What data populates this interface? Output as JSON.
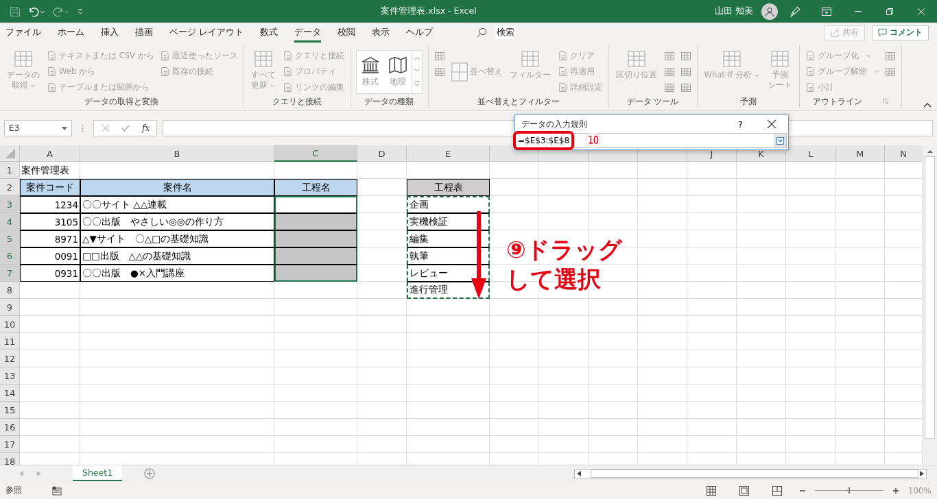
{
  "title_bar": {
    "title": "案件管理表.xlsx  -  Excel",
    "user": "山田 知美"
  },
  "ribbon_tabs": [
    {
      "label": "ファイル",
      "selected": false
    },
    {
      "label": "ホーム",
      "selected": false
    },
    {
      "label": "挿入",
      "selected": false
    },
    {
      "label": "描画",
      "selected": false
    },
    {
      "label": "ページ レイアウト",
      "selected": false
    },
    {
      "label": "数式",
      "selected": false
    },
    {
      "label": "データ",
      "selected": true
    },
    {
      "label": "校閲",
      "selected": false
    },
    {
      "label": "表示",
      "selected": false
    },
    {
      "label": "ヘルプ",
      "selected": false
    }
  ],
  "search": {
    "placeholder": "検索"
  },
  "share_button": "共有",
  "comment_button": "コメント",
  "ribbon_groups": [
    {
      "label": "データの取得と変換",
      "items": [
        {
          "kind": "large",
          "lines": [
            "データの",
            "取得"
          ],
          "caret": true
        },
        {
          "kind": "small",
          "label": "テキストまたは CSV から"
        },
        {
          "kind": "small",
          "label": "Web から"
        },
        {
          "kind": "small",
          "label": "テーブルまたは範囲から"
        },
        {
          "kind": "small",
          "label": "最近使ったソース"
        },
        {
          "kind": "small",
          "label": "既存の接続"
        }
      ]
    },
    {
      "label": "クエリと接続",
      "items": [
        {
          "kind": "large",
          "lines": [
            "すべて",
            "更新"
          ],
          "caret": true
        },
        {
          "kind": "small",
          "label": "クエリと接続"
        },
        {
          "kind": "small",
          "label": "プロパティ"
        },
        {
          "kind": "small",
          "label": "リンクの編集"
        }
      ]
    },
    {
      "label": "データの種類",
      "items": [
        {
          "kind": "gallery",
          "options": [
            "株式",
            "地理"
          ]
        }
      ]
    },
    {
      "label": "並べ替えとフィルター",
      "items": [
        {
          "kind": "icon"
        },
        {
          "kind": "icon"
        },
        {
          "kind": "side",
          "label": "並べ替え"
        },
        {
          "kind": "large",
          "lines": [
            "フィルター"
          ],
          "caret": false
        },
        {
          "kind": "small",
          "label": "クリア"
        },
        {
          "kind": "small",
          "label": "再適用"
        },
        {
          "kind": "small",
          "label": "詳細設定"
        }
      ]
    },
    {
      "label": "データ ツール",
      "items": [
        {
          "kind": "large",
          "lines": [
            "区切り位置"
          ],
          "caret": false
        },
        {
          "kind": "icon"
        },
        {
          "kind": "icon"
        },
        {
          "kind": "icon"
        },
        {
          "kind": "icon"
        },
        {
          "kind": "icon"
        },
        {
          "kind": "icon"
        }
      ]
    },
    {
      "label": "予測",
      "items": [
        {
          "kind": "large",
          "lines": [
            "What-If 分析"
          ],
          "caret": true
        },
        {
          "kind": "large",
          "lines": [
            "予測",
            "シート"
          ],
          "caret": false
        }
      ]
    },
    {
      "label": "アウトライン",
      "items": [
        {
          "kind": "small",
          "label": "グループ化",
          "caret": true
        },
        {
          "kind": "small",
          "label": "グループ解除",
          "caret": true
        },
        {
          "kind": "small",
          "label": "小計"
        },
        {
          "kind": "icon"
        },
        {
          "kind": "icon"
        }
      ]
    }
  ],
  "name_box": "E3",
  "function_label": "fx",
  "columns": [
    {
      "letter": "A",
      "selected": false
    },
    {
      "letter": "B",
      "selected": false
    },
    {
      "letter": "C",
      "selected": true
    },
    {
      "letter": "D",
      "selected": false
    },
    {
      "letter": "E",
      "selected": false
    },
    {
      "selected": false
    },
    {
      "selected": false
    },
    {
      "selected": false
    },
    {
      "selected": false
    },
    {
      "letter": "J",
      "selected": false
    },
    {
      "letter": "K",
      "selected": false
    },
    {
      "letter": "L",
      "selected": false
    },
    {
      "letter": "M",
      "selected": false
    },
    {
      "letter": "N",
      "selected": false
    }
  ],
  "rows": [
    {
      "number": "1",
      "selected": false,
      "cells": [
        {
          "text": "案件管理表",
          "kind": "text"
        }
      ]
    },
    {
      "number": "2",
      "selected": false,
      "cells": [
        {
          "text": "案件コード",
          "kind": "header"
        },
        {
          "text": "案件名",
          "kind": "header"
        },
        {
          "text": "工程名",
          "kind": "header"
        },
        {
          "kind": "empty"
        },
        {
          "text": "工程表",
          "kind": "list_header"
        }
      ]
    },
    {
      "number": "3",
      "selected": true,
      "active": true,
      "cells": [
        {
          "text": "1234",
          "kind": "number",
          "bordered": true
        },
        {
          "text": "〇〇サイト △△連載",
          "kind": "text",
          "bordered": true
        },
        {
          "kind": "empty",
          "bordered": true
        },
        {
          "kind": "empty"
        },
        {
          "text": "企画",
          "kind": "text",
          "marked": true
        }
      ]
    },
    {
      "number": "4",
      "selected": true,
      "cells": [
        {
          "text": "3105",
          "kind": "number",
          "bordered": true
        },
        {
          "text": "〇〇出版　やさしい◎◎の作り方",
          "kind": "text",
          "bordered": true
        },
        {
          "kind": "empty",
          "bordered": true
        },
        {
          "kind": "empty"
        },
        {
          "text": "実機検証",
          "kind": "text",
          "marked": true
        }
      ]
    },
    {
      "number": "5",
      "selected": true,
      "cells": [
        {
          "text": "8971",
          "kind": "number",
          "bordered": true
        },
        {
          "text": "△▼サイト　〇△□の基礎知識",
          "kind": "text",
          "bordered": true
        },
        {
          "kind": "empty",
          "bordered": true
        },
        {
          "kind": "empty"
        },
        {
          "text": "編集",
          "kind": "text",
          "marked": true
        }
      ]
    },
    {
      "number": "6",
      "selected": true,
      "cells": [
        {
          "text": "0091",
          "kind": "number",
          "bordered": true
        },
        {
          "text": "□□出版　△△の基礎知識",
          "kind": "text",
          "bordered": true
        },
        {
          "kind": "empty",
          "bordered": true
        },
        {
          "kind": "empty"
        },
        {
          "text": "執筆",
          "kind": "text",
          "marked": true
        }
      ]
    },
    {
      "number": "7",
      "selected": true,
      "cells": [
        {
          "text": "0931",
          "kind": "number",
          "bordered": true
        },
        {
          "text": "〇〇出版　●×入門講座",
          "kind": "text",
          "bordered": true
        },
        {
          "kind": "empty",
          "bordered": true
        },
        {
          "kind": "empty"
        },
        {
          "text": "レビュー",
          "kind": "text",
          "marked": true
        }
      ]
    },
    {
      "number": "8",
      "selected": false,
      "cells": [
        {
          "kind": "empty"
        },
        {
          "kind": "empty"
        },
        {
          "kind": "empty"
        },
        {
          "kind": "empty"
        },
        {
          "text": "進行管理",
          "kind": "text",
          "marked": true
        }
      ]
    },
    {
      "number": "9",
      "selected": false
    },
    {
      "number": "10",
      "selected": false
    },
    {
      "number": "11",
      "selected": false
    },
    {
      "number": "12",
      "selected": false
    },
    {
      "number": "13",
      "selected": false
    },
    {
      "number": "14",
      "selected": false
    },
    {
      "number": "15",
      "selected": false
    },
    {
      "number": "16",
      "selected": false
    },
    {
      "number": "17",
      "selected": false
    },
    {
      "number": "18",
      "selected": false
    }
  ],
  "dialog": {
    "title": "データの入力規則",
    "help": "?",
    "value": "=$E$3:$E$8",
    "highlighted": true
  },
  "annotations": [
    {
      "kind": "step_badge",
      "text": "⑩"
    },
    {
      "kind": "callout",
      "lines": [
        "⑨ドラッグ",
        "して選択"
      ]
    },
    {
      "kind": "arrow"
    }
  ],
  "sheet_tabs": [
    {
      "label": "Sheet1",
      "selected": true
    }
  ],
  "status_bar": {
    "mode": "参照",
    "zoom": {
      "level": 0.5,
      "reading": "100%"
    }
  }
}
